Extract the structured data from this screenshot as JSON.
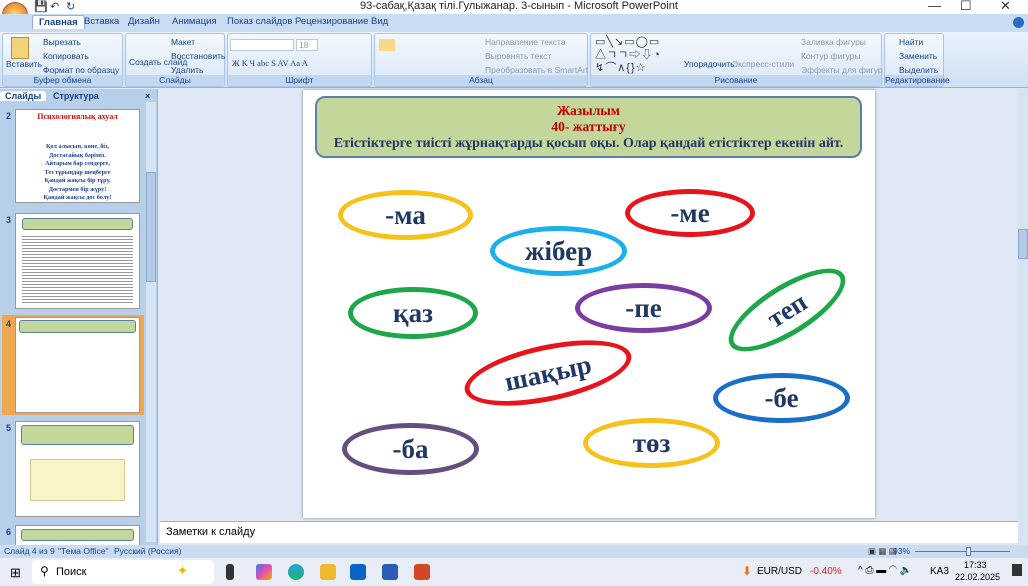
{
  "window": {
    "title": "93-сабақ,Қазақ тілі.Гулыжанар. 3-сынып     - Microsoft PowerPoint",
    "minimize": "—",
    "maximize": "☐",
    "close": "✕"
  },
  "tabs": [
    "Главная",
    "Вставка",
    "Дизайн",
    "Анимация",
    "Показ слайдов",
    "Рецензирование",
    "Вид"
  ],
  "ribbon": {
    "clipboard": {
      "label": "Буфер обмена",
      "paste": "Вставить",
      "cut": "Вырезать",
      "copy": "Копировать",
      "format": "Формат по образцу"
    },
    "slides": {
      "label": "Слайды",
      "new": "Создать слайд",
      "layout": "Макет",
      "reset": "Восстановить",
      "delete": "Удалить"
    },
    "font": {
      "label": "Шрифт",
      "size": "18"
    },
    "paragraph": {
      "label": "Абзац",
      "dir": "Направление текста",
      "align": "Выровнять текст",
      "smartart": "Преобразовать в SmartArt"
    },
    "drawing": {
      "label": "Рисование",
      "arrange": "Упорядочить",
      "styles": "Экспресс-стили",
      "fill": "Заливка фигуры",
      "outline": "Контур фигуры",
      "effects": "Эффекты для фигур"
    },
    "editing": {
      "label": "Редактирование",
      "find": "Найти",
      "replace": "Заменить",
      "select": "Выделить"
    }
  },
  "pane": {
    "tab_slides": "Слайды",
    "tab_outline": "Структура",
    "close": "×",
    "slide2": {
      "num": "2",
      "title": "Психологиялық ахуал",
      "lines": [
        "Қол алысып, көне, біз,",
        "Достасайық бәріміз.",
        "Айтарым бар сендерге,",
        "Тез тұрыңдар шеңберге",
        "Қандай жақсы бір тұру,",
        "Достармен бір жүру!",
        "Қандай жақсы дос болу!"
      ]
    },
    "slide3": {
      "num": "3"
    },
    "slide4": {
      "num": "4"
    },
    "slide5": {
      "num": "5"
    },
    "slide6": {
      "num": "6"
    }
  },
  "slide": {
    "title": "Жазылым",
    "exercise": "40-  жаттығу",
    "instruction": "Етістіктерге тиісті жұрнақтарды қосып оқы. Олар қандай етістіктер екенін айт.",
    "words": [
      "-ма",
      "-ме",
      "жібер",
      "қаз",
      "-пе",
      "теп",
      "шақыр",
      "-бе",
      "-ба",
      "төз"
    ],
    "colors": {
      "yellow": "#f4c21b",
      "red": "#e8141c",
      "blue_light": "#1bb0ea",
      "green": "#1ea64b",
      "purple": "#7a3ea0",
      "blue": "#1a6ec6",
      "purple2": "#64507f"
    }
  },
  "notes": "Заметки к слайду",
  "status": {
    "slide": "Слайд 4 из 9",
    "theme": "\"Тема Office\"",
    "lang": "Русский (Россия)",
    "zoom": "93%"
  },
  "taskbar": {
    "search": "Поиск",
    "ticker": "EUR/USD",
    "change": "-0.40%",
    "lang": "KA3",
    "time": "17:33",
    "date": "22.02.2025"
  }
}
